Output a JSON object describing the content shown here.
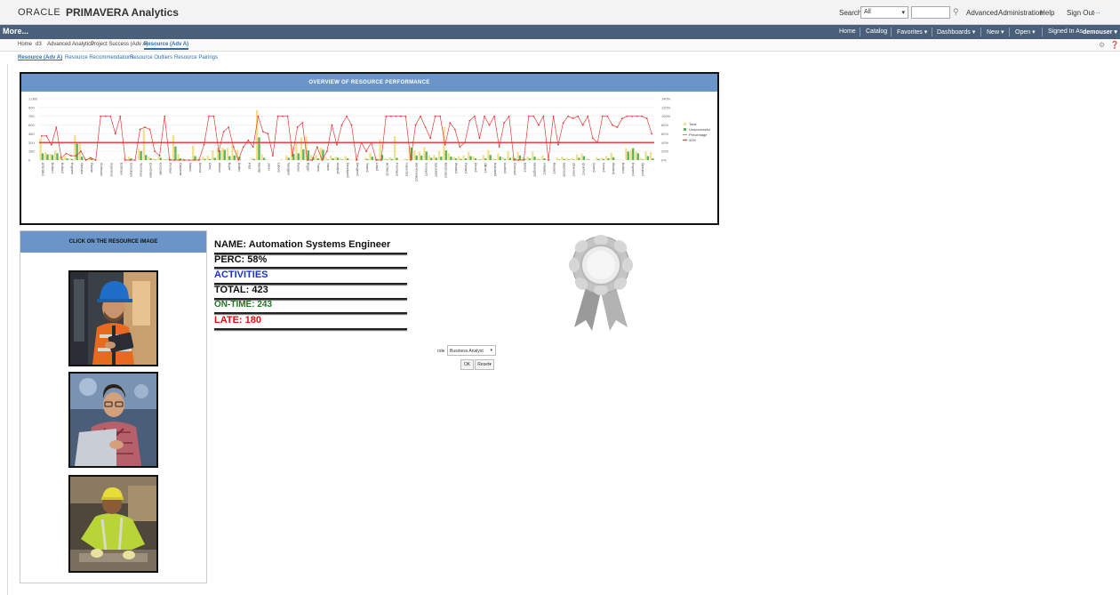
{
  "header": {
    "oracle": "ORACLE",
    "product": "PRIMAVERA Analytics",
    "search_label": "Search",
    "search_scope": "All",
    "links": [
      "Advanced",
      "Administration",
      "Help",
      "Sign Out"
    ]
  },
  "navbar": {
    "more": "More...",
    "items": [
      "Home",
      "Catalog",
      "Favorites ▾",
      "Dashboards ▾",
      "New ▾",
      "Open ▾",
      "Signed In As"
    ],
    "user": "demouser ▾"
  },
  "tabs": [
    "Home",
    "d3",
    "Advanced Analytics",
    "Project Success (Adv A)",
    "Resource (Adv A)"
  ],
  "subtabs": [
    "Resource (Adv A)",
    "Resource Recommendations",
    "Resource Outliers",
    "Resource Pairings"
  ],
  "chart_header": "OVERVIEW OF RESOURCE PERFORMANCE",
  "chart_data": {
    "type": "bar",
    "left_ticks": [
      "1,080",
      "900",
      "760",
      "600",
      "480",
      "300",
      "180",
      "0"
    ],
    "right_ticks": [
      "140%",
      "120%",
      "100%",
      "80%",
      "60%",
      "40%",
      "20%",
      "0%"
    ],
    "ylim": [
      0,
      1080
    ],
    "y2lim": [
      0,
      140
    ],
    "reference_percent": 40,
    "legend": [
      "Total",
      "Unsuccessful",
      "Percentage",
      "40%"
    ],
    "series": [
      {
        "name": "Total",
        "color": "#f2e08a",
        "values": [
          380,
          140,
          110,
          170,
          60,
          70,
          30,
          440,
          320,
          40,
          60,
          10,
          10,
          0,
          0,
          0,
          0,
          40,
          60,
          0,
          200,
          540,
          60,
          30,
          60,
          20,
          40,
          440,
          110,
          30,
          0,
          250,
          40,
          60,
          80,
          170,
          210,
          220,
          210,
          270,
          180,
          0,
          0,
          40,
          880,
          100,
          10,
          0,
          0,
          20,
          80,
          270,
          300,
          400,
          420,
          90,
          100,
          220,
          50,
          80,
          60,
          40,
          70,
          10,
          20,
          0,
          40,
          130,
          40,
          360,
          30,
          50,
          420,
          10,
          20,
          240,
          170,
          150,
          230,
          80,
          90,
          160,
          580,
          120,
          60,
          70,
          80,
          140,
          60,
          20,
          90,
          180,
          30,
          120,
          50,
          150,
          60,
          140,
          50,
          60,
          150,
          40,
          80,
          20,
          0,
          40,
          60,
          40,
          40,
          100,
          120,
          30,
          0,
          50,
          40,
          70,
          130,
          10,
          10,
          210,
          180,
          150,
          40,
          150,
          140
        ]
      },
      {
        "name": "Unsuccessful",
        "color": "#5ab55a",
        "values": [
          120,
          100,
          90,
          120,
          20,
          30,
          20,
          290,
          60,
          10,
          30,
          0,
          0,
          0,
          0,
          0,
          0,
          10,
          30,
          0,
          160,
          90,
          30,
          10,
          40,
          10,
          20,
          240,
          30,
          10,
          0,
          70,
          10,
          20,
          20,
          40,
          170,
          180,
          70,
          80,
          60,
          0,
          0,
          20,
          400,
          40,
          0,
          0,
          0,
          0,
          40,
          110,
          120,
          190,
          170,
          50,
          30,
          180,
          10,
          30,
          40,
          10,
          30,
          0,
          10,
          0,
          20,
          60,
          20,
          90,
          10,
          20,
          40,
          0,
          10,
          220,
          80,
          80,
          150,
          40,
          40,
          60,
          170,
          60,
          30,
          20,
          30,
          70,
          30,
          10,
          30,
          90,
          10,
          60,
          20,
          40,
          30,
          80,
          20,
          30,
          60,
          10,
          30,
          10,
          0,
          10,
          20,
          10,
          10,
          40,
          70,
          10,
          0,
          20,
          20,
          30,
          50,
          0,
          0,
          150,
          210,
          120,
          10,
          70,
          30
        ]
      },
      {
        "name": "Percentage",
        "color": "#e23b3b",
        "values": [
          55,
          55,
          35,
          75,
          5,
          15,
          10,
          10,
          20,
          0,
          5,
          0,
          100,
          100,
          100,
          60,
          100,
          0,
          0,
          0,
          70,
          75,
          70,
          20,
          10,
          100,
          0,
          0,
          0,
          0,
          0,
          0,
          0,
          35,
          100,
          100,
          20,
          65,
          75,
          30,
          0,
          30,
          45,
          30,
          100,
          65,
          60,
          10,
          100,
          100,
          100,
          10,
          75,
          85,
          0,
          0,
          30,
          0,
          20,
          80,
          35,
          80,
          100,
          80,
          0,
          40,
          20,
          40,
          0,
          0,
          100,
          100,
          100,
          100,
          100,
          0,
          80,
          100,
          75,
          50,
          100,
          100,
          35,
          85,
          70,
          30,
          40,
          90,
          100,
          50,
          100,
          80,
          100,
          30,
          85,
          100,
          0,
          0,
          0,
          100,
          100,
          80,
          100,
          0,
          100,
          35,
          85,
          100,
          95,
          100,
          80,
          100,
          50,
          40,
          100,
          100,
          80,
          75,
          95,
          100,
          100,
          100,
          100,
          95,
          60
        ]
      }
    ],
    "categories": [
      "ATM DEO",
      "Analyst",
      "Builder1",
      "Developer",
      "Builder2",
      "Manager",
      "Engineer",
      "Designer",
      "Operator",
      "Tester",
      "Planner",
      "Lead",
      "Scheduler",
      "Architect",
      "Supervisor",
      "Foreman",
      "Estimator",
      "Inspector",
      "Consultant",
      "Administrator",
      "Technician",
      "Surveyor",
      "Coordinator",
      "Specialist",
      "Controller",
      "Electrician",
      "Plumber",
      "Welder",
      "Carpenter",
      "Painter",
      "Mason",
      "Driver",
      "Director",
      "Officer",
      "Clerk",
      "Assistant",
      "Advisor",
      "Auditor",
      "Buyer",
      "Chemist",
      "Drafter",
      "Editor",
      "Fitter",
      "Geologist",
      "Handler",
      "Installer",
      "Joiner",
      "Keeper",
      "Laborer",
      "Machinist",
      "Navigator",
      "Observer",
      "Packer",
      "Quarrier",
      "Rigger",
      "Sorter",
      "Trainer",
      "Usher",
      "Valuer",
      "Warden",
      "Analyst2",
      "Builder3",
      "Developer2",
      "Engineer2",
      "Designer2",
      "Operator2",
      "Tester2",
      "Planner2",
      "Lead2",
      "Scheduler2",
      "Architect2",
      "Supervisor2",
      "Foreman2",
      "Estimator2",
      "Inspector2",
      "Consultant2",
      "Administrator2",
      "Technician2",
      "Surveyor2",
      "Coordinator2",
      "Specialist2",
      "Controller2",
      "Electrician2",
      "Plumber2",
      "Welder2",
      "Carpenter2",
      "Painter2",
      "Mason2",
      "Driver2",
      "Director2",
      "Officer2",
      "Clerk2",
      "Assistant2",
      "Advisor2",
      "Auditor2",
      "Buyer2",
      "Chemist2",
      "Drafter2",
      "Editor2",
      "Fitter2",
      "Geologist2",
      "Handler2",
      "Installer2",
      "Joiner2",
      "Keeper2",
      "Laborer2",
      "Machinist2",
      "Navigator2",
      "Observer2",
      "Packer2",
      "Quarrier2",
      "Rigger2",
      "Sorter2",
      "Trainer2",
      "Usher2",
      "Valuer2",
      "Warden2",
      "Analyst3",
      "Builder4",
      "Developer3",
      "Engineer3",
      "Designer3",
      "Operator3"
    ]
  },
  "resource_panel": {
    "header": "CLICK ON THE RESOURCE IMAGE"
  },
  "details": {
    "name": "NAME: Automation Systems Engineer",
    "perc": "PERC: 58%",
    "activities": "ACTIVITIES",
    "total": "TOTAL: 423",
    "on_time": "ON-TIME: 243",
    "late": "LATE: 180"
  },
  "filter": {
    "role_label": "role",
    "role_value": "Business Analyst",
    "ok": "OK",
    "reset": "Reset▾"
  },
  "colors": {
    "accent": "#6b94c8",
    "nav": "#4a5f7a",
    "on_time": "#1f7a1f",
    "late": "#e01010",
    "activities": "#1b2fd6"
  }
}
